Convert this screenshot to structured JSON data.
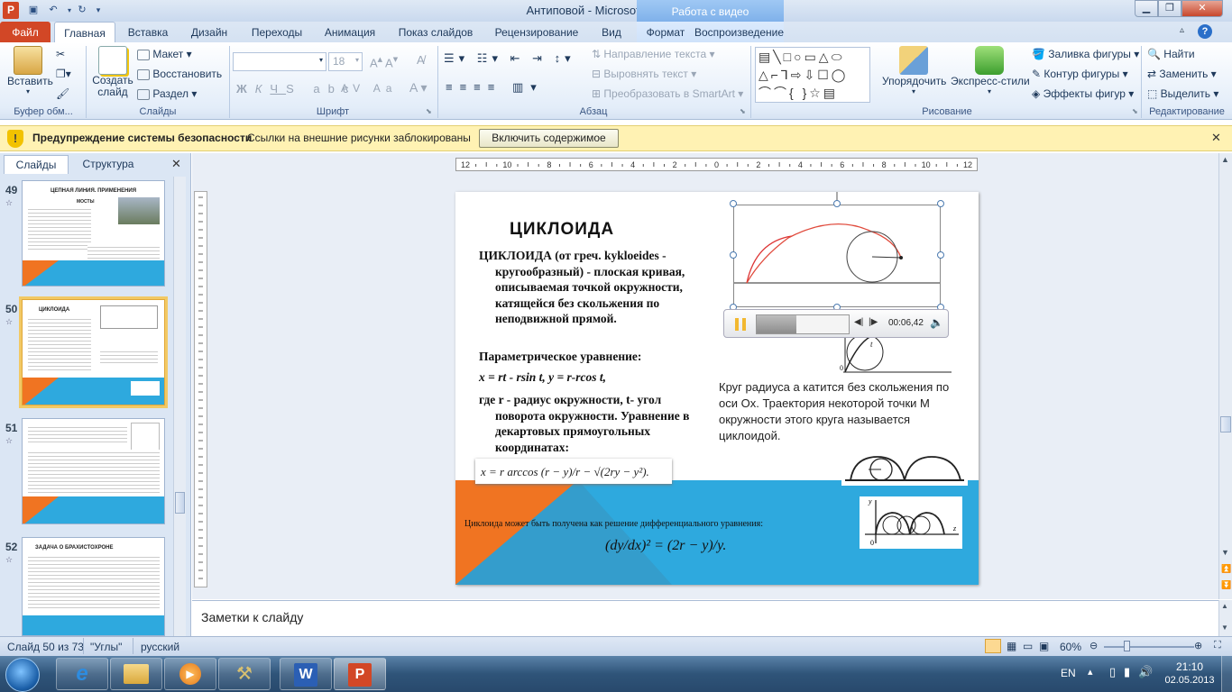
{
  "window": {
    "title": "Антиповой  -  Microsoft PowerPoint",
    "context_header": "Работа с видео"
  },
  "tabs": [
    {
      "label": "Файл"
    },
    {
      "label": "Главная"
    },
    {
      "label": "Вставка"
    },
    {
      "label": "Дизайн"
    },
    {
      "label": "Переходы"
    },
    {
      "label": "Анимация"
    },
    {
      "label": "Показ слайдов"
    },
    {
      "label": "Рецензирование"
    },
    {
      "label": "Вид"
    },
    {
      "label": "Формат"
    },
    {
      "label": "Воспроизведение"
    }
  ],
  "ribbon": {
    "clipboard": {
      "paste": "Вставить",
      "label": "Буфер обм..."
    },
    "slides": {
      "create": "Создать слайд",
      "layout": "Макет",
      "reset": "Восстановить",
      "section": "Раздел",
      "label": "Слайды"
    },
    "font": {
      "font_size": "18",
      "label": "Шрифт"
    },
    "paragraph": {
      "text_direction": "Направление текста",
      "align_text": "Выровнять текст",
      "smartart": "Преобразовать в SmartArt",
      "label": "Абзац"
    },
    "drawing": {
      "arrange": "Упорядочить",
      "quick_styles": "Экспресс-стили",
      "fill": "Заливка фигуры",
      "outline": "Контур фигуры",
      "effects": "Эффекты фигур",
      "label": "Рисование"
    },
    "editing": {
      "find": "Найти",
      "replace": "Заменить",
      "select": "Выделить",
      "label": "Редактирование"
    }
  },
  "security_bar": {
    "title": "Предупреждение системы безопасности",
    "message": "Ссылки на внешние рисунки заблокированы",
    "button": "Включить содержимое"
  },
  "left_panel": {
    "tabs": [
      "Слайды",
      "Структура"
    ],
    "slides": [
      {
        "number": "49",
        "title": "ЦЕПНАЯ ЛИНИЯ. ПРИМЕНЕНИЯ",
        "subtitle": "МОСТЫ"
      },
      {
        "number": "50",
        "title": "ЦИКЛОИДА"
      },
      {
        "number": "51",
        "title": ""
      },
      {
        "number": "52",
        "title": "ЗАДАЧА О БРАХИСТОХРОНЕ"
      }
    ]
  },
  "ruler": {
    "ticks": [
      "12",
      "10",
      "8",
      "6",
      "4",
      "2",
      "0",
      "2",
      "4",
      "6",
      "8",
      "10",
      "12"
    ]
  },
  "slide": {
    "title": "ЦИКЛОИДА",
    "definition": "ЦИКЛОИДА (от греч. kykloeides - кругообразный) - плоская кривая, описываемая точкой окружности, катящейся без скольжения по неподвижной прямой.",
    "param_heading": "Параметрическое уравнение:",
    "param_eq": "x = rt - rsin t, y = r-rcos t,",
    "where_text": "где r - радиус окружности, t- угол поворота окружности. Уравнение в декартовых прямоугольных координатах:",
    "cartesian_eq": "x = r arccos (r − y)/r − √(2ry − y²).",
    "circle_caption": "Круг радиуса а катится без скольжения по оси Ox. Траектория некоторой точки M окружности этого круга называется циклоидой.",
    "diff_caption": "Циклоида может быть получена как решение дифференциального уравнения:",
    "diff_eq": "(dy/dx)² = (2r − y)/y."
  },
  "video_player": {
    "time": "00:06,42",
    "progress": 0.43
  },
  "notes": {
    "placeholder": "Заметки к слайду"
  },
  "status": {
    "slide_info": "Слайд 50 из 73",
    "theme": "\"Углы\"",
    "language": "русский",
    "zoom": "60%"
  },
  "taskbar": {
    "lang": "EN",
    "time": "21:10",
    "date": "02.05.2013"
  },
  "colors": {
    "file_tab": "#d24726",
    "accent_orange": "#f07422",
    "accent_blue": "#2ea9de",
    "security_bar": "#fff2b3"
  }
}
